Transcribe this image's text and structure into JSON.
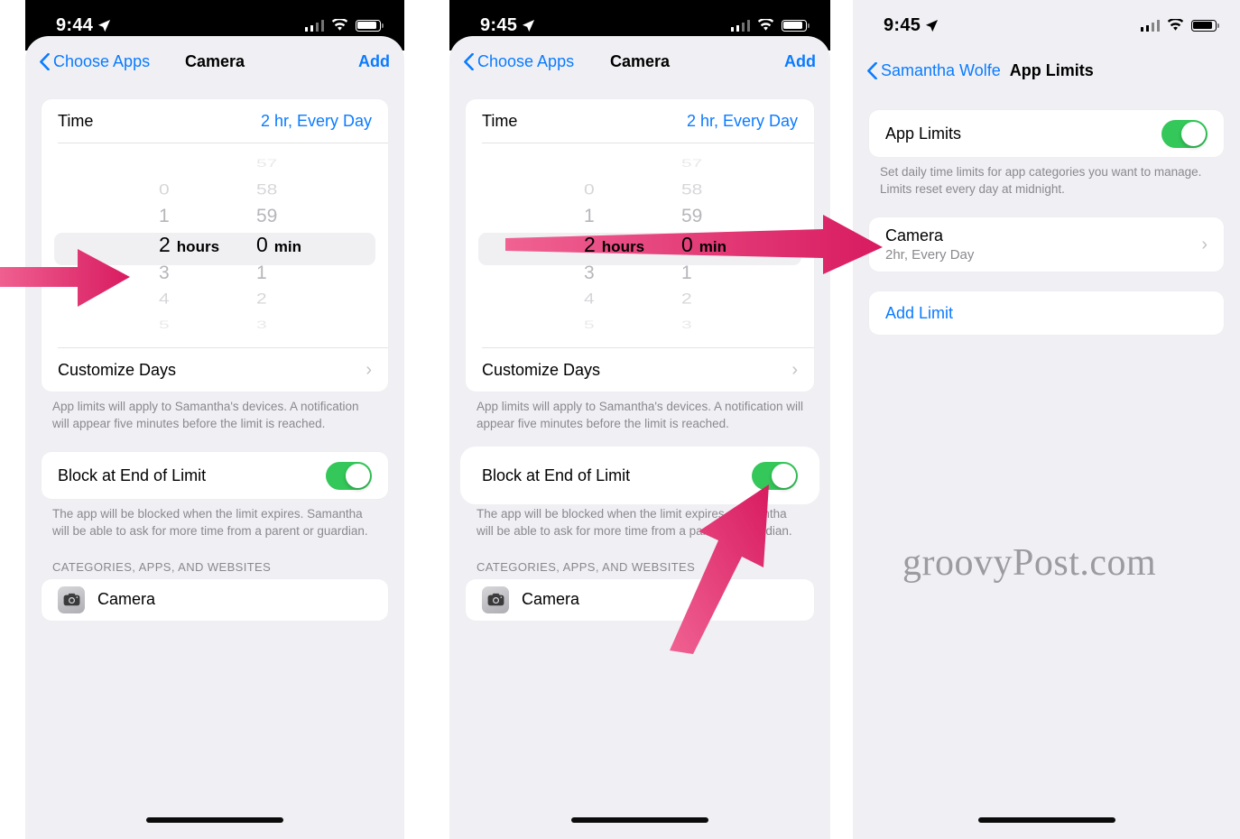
{
  "colors": {
    "accent_blue": "#0a7bff",
    "toggle_green": "#34c759",
    "arrow_pink": "#e23b77",
    "background_gray": "#f0f0f4",
    "card_white": "#ffffff",
    "muted_text": "#8a8a8e"
  },
  "watermark": "groovyPost.com",
  "panel1": {
    "status": {
      "time": "9:44",
      "location_icon": "location-arrow",
      "cellular_icon": "cellular-bars",
      "wifi_icon": "wifi",
      "battery_icon": "battery-full"
    },
    "nav": {
      "back_label": "Choose Apps",
      "title": "Camera",
      "action_label": "Add"
    },
    "time_row": {
      "label": "Time",
      "value": "2 hr, Every Day"
    },
    "picker": {
      "hours": {
        "above": [
          "",
          "0",
          "1"
        ],
        "selected": "2",
        "selected_unit": "hours",
        "below": [
          "3",
          "4",
          "5"
        ]
      },
      "minutes": {
        "above": [
          "57",
          "58",
          "59"
        ],
        "selected": "0",
        "selected_unit": "min",
        "below": [
          "1",
          "2",
          "3"
        ]
      }
    },
    "customize_days": {
      "label": "Customize Days"
    },
    "footnote1": "App limits will apply to Samantha's devices. A notification will appear five minutes before the limit is reached.",
    "block_row": {
      "label": "Block at End of Limit",
      "toggle_on": true
    },
    "footnote2": "The app will be blocked when the limit expires. Samantha will be able to ask for more time from a parent or guardian.",
    "section_header": "CATEGORIES, APPS, AND WEBSITES",
    "app_row": {
      "icon": "camera-app-icon",
      "label": "Camera"
    }
  },
  "panel2": {
    "status": {
      "time": "9:45",
      "location_icon": "location-arrow",
      "cellular_icon": "cellular-bars",
      "wifi_icon": "wifi",
      "battery_icon": "battery-full"
    },
    "nav": {
      "back_label": "Choose Apps",
      "title": "Camera",
      "action_label": "Add"
    },
    "time_row": {
      "label": "Time",
      "value": "2 hr, Every Day"
    },
    "picker": {
      "hours": {
        "above": [
          "",
          "0",
          "1"
        ],
        "selected": "2",
        "selected_unit": "hours",
        "below": [
          "3",
          "4",
          "5"
        ]
      },
      "minutes": {
        "above": [
          "57",
          "58",
          "59"
        ],
        "selected": "0",
        "selected_unit": "min",
        "below": [
          "1",
          "2",
          "3"
        ]
      }
    },
    "customize_days": {
      "label": "Customize Days"
    },
    "footnote1": "App limits will apply to Samantha's devices. A notification will appear five minutes before the limit is reached.",
    "block_row": {
      "label": "Block at End of Limit",
      "toggle_on": true
    },
    "footnote2": "The app will be blocked when the limit expires. Samantha will be able to ask for more time from a parent or guardian.",
    "section_header": "CATEGORIES, APPS, AND WEBSITES",
    "app_row": {
      "icon": "camera-app-icon",
      "label": "Camera"
    }
  },
  "panel3": {
    "status": {
      "time": "9:45",
      "location_icon": "location-arrow",
      "cellular_icon": "cellular-bars",
      "wifi_icon": "wifi",
      "battery_icon": "battery-full"
    },
    "nav": {
      "back_label": "Samantha Wolfe",
      "title": "App Limits"
    },
    "app_limits_row": {
      "label": "App Limits",
      "toggle_on": true
    },
    "footnote": "Set daily time limits for app categories you want to manage. Limits reset every day at midnight.",
    "camera_row": {
      "title": "Camera",
      "subtitle": "2hr, Every Day"
    },
    "add_limit": {
      "label": "Add Limit"
    }
  }
}
